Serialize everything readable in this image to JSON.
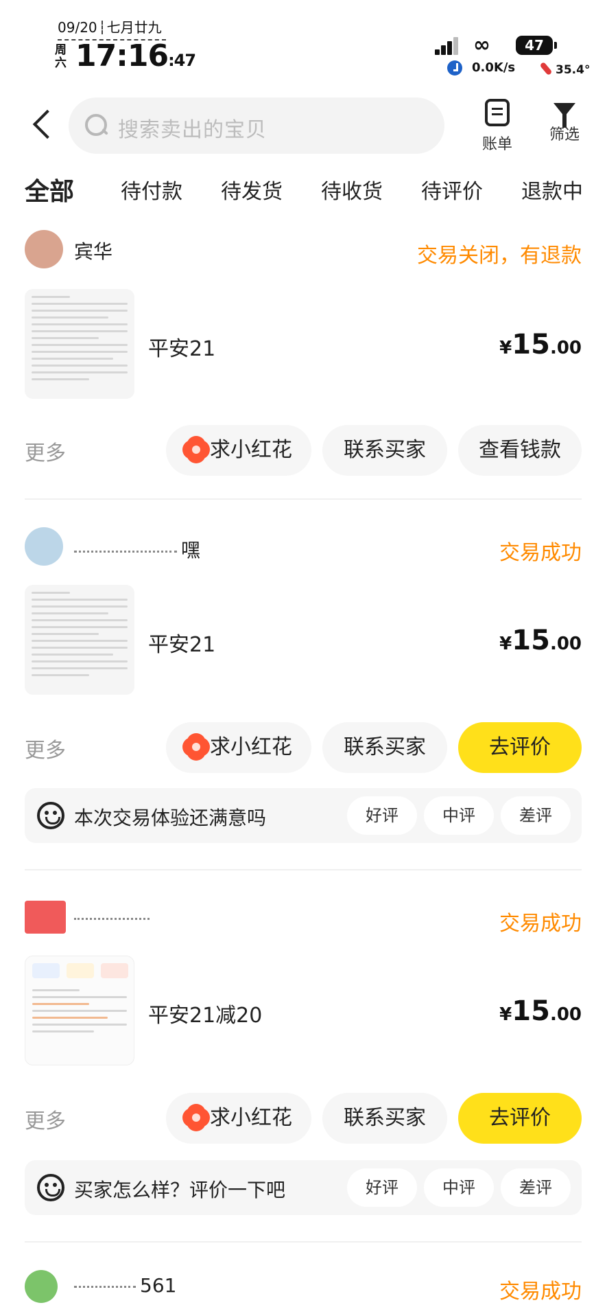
{
  "status_bar": {
    "date": "09/20",
    "lunar": "七月廿九",
    "weekday": "周六",
    "time": "17:16",
    "seconds": ":47",
    "battery": "47",
    "net_speed": "0.0K/s",
    "temperature": "35.4°"
  },
  "header": {
    "search_placeholder": "搜索卖出的宝贝",
    "bill_label": "账单",
    "filter_label": "筛选"
  },
  "tabs": [
    "全部",
    "待付款",
    "待发货",
    "待收货",
    "待评价",
    "退款中"
  ],
  "orders": [
    {
      "buyer": "宾华",
      "state": "交易关闭，有退款",
      "title": "平安21",
      "price_symbol": "¥",
      "price_int": "15",
      "price_dec": ".00",
      "more": "更多",
      "buttons": [
        "求小红花",
        "联系买家",
        "查看钱款"
      ]
    },
    {
      "buyer": "嘿",
      "state": "交易成功",
      "title": "平安21",
      "price_symbol": "¥",
      "price_int": "15",
      "price_dec": ".00",
      "more": "更多",
      "buttons": [
        "求小红花",
        "联系买家",
        "去评价"
      ],
      "rating": {
        "question": "本次交易体验还满意吗",
        "chips": [
          "好评",
          "中评",
          "差评"
        ]
      }
    },
    {
      "buyer": "",
      "state": "交易成功",
      "title": "平安21减20",
      "price_symbol": "¥",
      "price_int": "15",
      "price_dec": ".00",
      "more": "更多",
      "buttons": [
        "求小红花",
        "联系买家",
        "去评价"
      ],
      "rating": {
        "question": "买家怎么样？评价一下吧",
        "chips": [
          "好评",
          "中评",
          "差评"
        ]
      }
    },
    {
      "buyer": "561",
      "state": "交易成功"
    }
  ]
}
